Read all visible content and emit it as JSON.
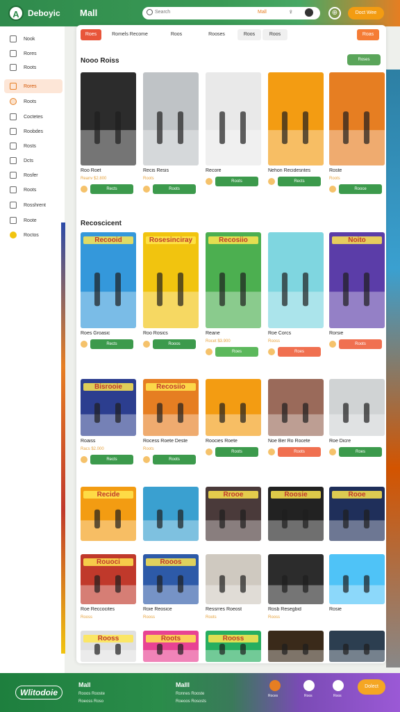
{
  "header": {
    "brand": "Deboyic",
    "title": "Mall",
    "search_placeholder": "Search",
    "search_tag": "Mall",
    "button": "Doct Wee"
  },
  "sidebar": {
    "items": [
      "Nook",
      "Rores",
      "Roots",
      "Rores",
      "Roots",
      "Coctetes",
      "Roobdes",
      "Rosts",
      "Dcts",
      "Rosfer",
      "Roots",
      "Rosshrent",
      "Roote",
      "Roctos"
    ],
    "active_index": 3
  },
  "tabs": [
    "Roes",
    "Romels Recome",
    "Roos",
    "Rooses",
    "Roos",
    "Roos",
    "Roas"
  ],
  "section1": {
    "title": "Nooo Roiss",
    "button": "Roses"
  },
  "section2": {
    "title": "Recoscicent"
  },
  "cards_r1": [
    {
      "title": "Roo Roet",
      "price": "Reanv $2.800",
      "btn": "Rects"
    },
    {
      "title": "Recis Resis",
      "price": "Roots",
      "btn": "Roots"
    },
    {
      "title": "Recore",
      "price": "",
      "btn": "Roots"
    },
    {
      "title": "Nehon Recidesntes",
      "price": "",
      "btn": "Rects"
    },
    {
      "title": "Roste",
      "price": "Roots",
      "btn": "Rooce"
    }
  ],
  "cards_r2": [
    {
      "title": "Roes Groasic",
      "price": "",
      "btn": "Rects",
      "img_text": "Recooid"
    },
    {
      "title": "Roo Rosics",
      "price": "",
      "btn": "Rooos",
      "img_text": "Rosesinciray"
    },
    {
      "title": "Reane",
      "price": "Rocet $3.900",
      "btn": "Roes",
      "img_text": "Recosiio"
    },
    {
      "title": "Roe Corcs",
      "price": "Rooss",
      "btn": "Roes",
      "img_text": ""
    },
    {
      "title": "Rorsie",
      "price": "",
      "btn": "Roots",
      "img_text": "Noito"
    }
  ],
  "cards_r3": [
    {
      "title": "Roaiss",
      "price": "Racs $2.000",
      "btn": "Rects",
      "img_text": "Bisrooie"
    },
    {
      "title": "Rocess Roete Deste",
      "price": "Roots",
      "btn": "Roots",
      "img_text": "Recosiio"
    },
    {
      "title": "Roocies Roete",
      "price": "",
      "btn": "Roots",
      "img_text": ""
    },
    {
      "title": "Noe Ber Ro Rocete",
      "price": "",
      "btn": "Roots",
      "img_text": ""
    },
    {
      "title": "Roe Dicre",
      "price": "",
      "btn": "Roes",
      "img_text": ""
    }
  ],
  "cards_r4": [
    {
      "img_text": "Recide"
    },
    {
      "img_text": ""
    },
    {
      "img_text": "Rrooe"
    },
    {
      "img_text": "Roosie"
    },
    {
      "img_text": "Rooe"
    }
  ],
  "cards_r5": [
    {
      "title": "Roe Reccocites",
      "price": "Rooss",
      "img_text": "Rouoci"
    },
    {
      "title": "Roie Reosice",
      "price": "Rooss",
      "img_text": "Rooos"
    },
    {
      "title": "Ressrres Roeost",
      "price": "Roots",
      "img_text": ""
    },
    {
      "title": "Rosb Resegbid",
      "price": "Rooss",
      "img_text": ""
    },
    {
      "title": "Rosie",
      "price": "",
      "img_text": ""
    }
  ],
  "cards_r6": [
    {
      "img_text": "Rooss"
    },
    {
      "img_text": "Roots"
    },
    {
      "img_text": "Rooss"
    },
    {
      "img_text": ""
    },
    {
      "img_text": ""
    }
  ],
  "footer": {
    "logo": "Wlitodoie",
    "title1": "Mall",
    "sub1a": "Rooos Rooste",
    "sub1b": "Roeoss Roso",
    "title2": "Malll",
    "sub2a": "Ronnes Rooste",
    "sub2b": "Roeoos Rososts",
    "icons": [
      "Roces",
      "Roos",
      "Roos"
    ],
    "button": "Dolect"
  },
  "colors": {
    "green": "#2f8a4c",
    "orange": "#e67e22",
    "coral": "#e8553a",
    "purple": "#9b59d6"
  }
}
